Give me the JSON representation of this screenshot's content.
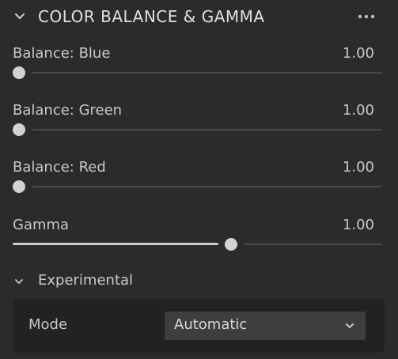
{
  "panel": {
    "title": "COLOR BALANCE & GAMMA",
    "collapse_icon": "chevron-down-icon",
    "more_icon": "more-horizontal-icon",
    "params": [
      {
        "label": "Balance: Blue",
        "value_text": "1.00",
        "position": 0.0
      },
      {
        "label": "Balance: Green",
        "value_text": "1.00",
        "position": 0.0
      },
      {
        "label": "Balance: Red",
        "value_text": "1.00",
        "position": 0.0
      },
      {
        "label": "Gamma",
        "value_text": "1.00",
        "position": 0.59
      }
    ],
    "experimental": {
      "title": "Experimental",
      "collapse_icon": "chevron-down-icon",
      "mode_label": "Mode",
      "mode_value": "Automatic"
    }
  },
  "colors": {
    "background": "#2b2b2b",
    "text": "#c9c9c9",
    "track": "#4a4a4a",
    "knob": "#d2d2d2",
    "dropdown_bg": "#3e3e3e",
    "subsection_bg": "#222222"
  }
}
